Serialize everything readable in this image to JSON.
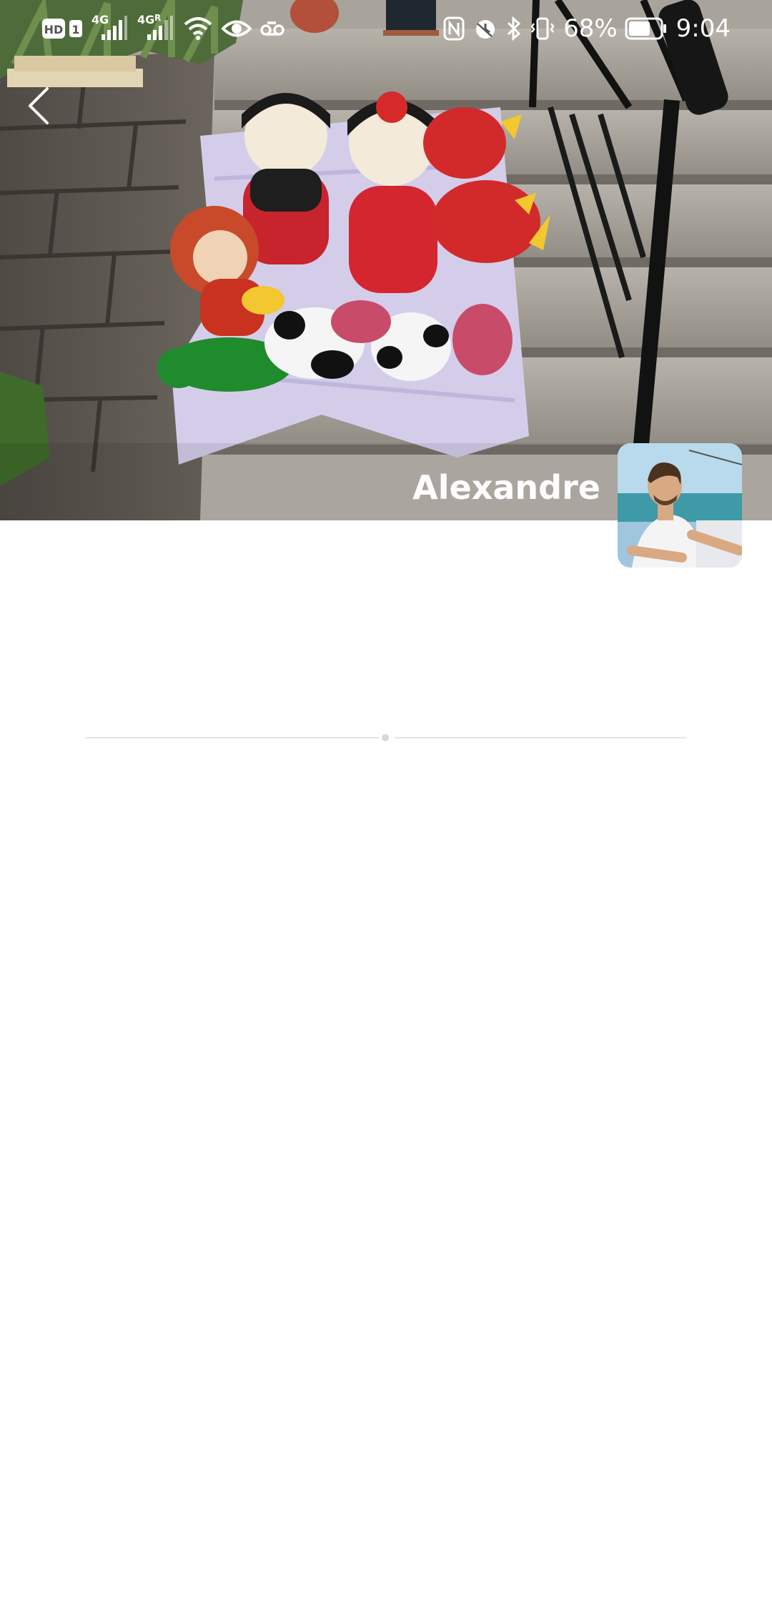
{
  "status_bar": {
    "left_icons": [
      "hd-icon",
      "sim-1-badge",
      "signal-4g-icon",
      "signal-4g-roaming-icon",
      "wifi-icon",
      "eye-comfort-icon",
      "voicemail-icon"
    ],
    "hd_label": "HD",
    "sim_label": "1",
    "network_1": "4G",
    "network_2": "4G",
    "network_2_roaming": "R",
    "right_icons": [
      "nfc-icon",
      "alarm-icon",
      "bluetooth-icon",
      "vibrate-icon",
      "battery-icon"
    ],
    "battery_percent": "68%",
    "battery_level": 0.68,
    "time": "9:04"
  },
  "navigation": {
    "back_icon": "chevron-left-icon"
  },
  "profile": {
    "name": "Alexandre",
    "cover_description_icon": "cover-photo",
    "avatar_icon": "avatar-photo"
  },
  "colors": {
    "background": "#ffffff",
    "overlay_text": "#ffffff",
    "divider": "#e6e6e6"
  }
}
